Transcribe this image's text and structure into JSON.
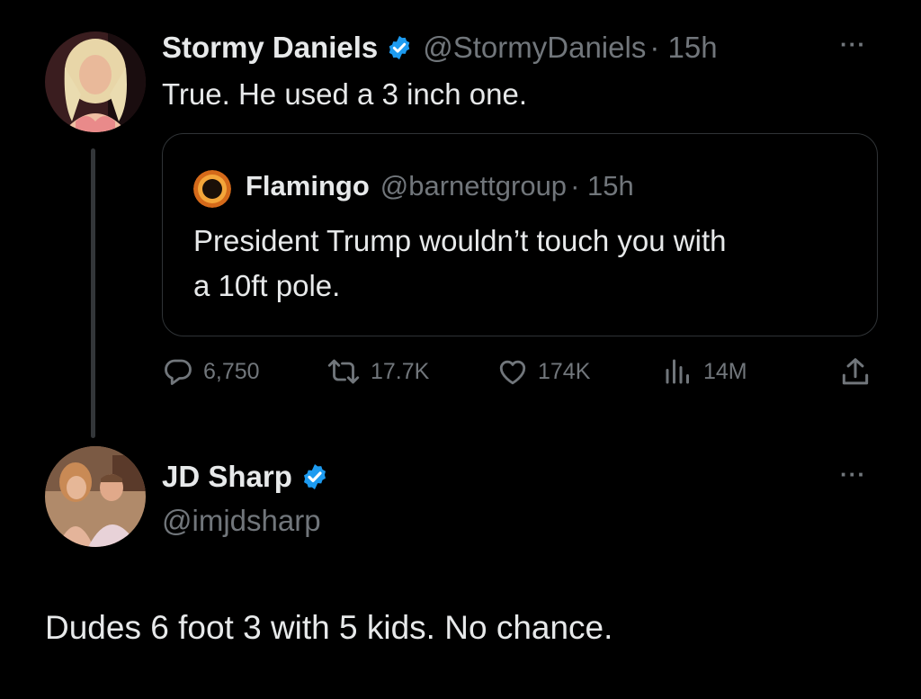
{
  "tweets": [
    {
      "display_name": "Stormy Daniels",
      "handle": "@StormyDaniels",
      "time": "· 15h",
      "text": "True. He used a 3 inch one.",
      "avatar": "woman-blonde-avatar",
      "quote": {
        "display_name": "Flamingo",
        "handle": "@barnettgroup",
        "time": "· 15h",
        "text_line1": "President Trump wouldn’t touch you with",
        "text_line2": "a 10ft pole.",
        "avatar": "eclipse-avatar"
      },
      "stats": {
        "replies": "6,750",
        "reposts": "17.7K",
        "likes": "174K",
        "views": "14M"
      }
    },
    {
      "display_name": "JD Sharp",
      "handle": "@imjdsharp",
      "text": "Dudes 6 foot 3 with 5 kids.  No chance.",
      "avatar": "couple-photo-avatar"
    }
  ],
  "icons": {
    "verified": "verified-badge-icon",
    "more": "more-options-icon",
    "reply": "reply-icon",
    "repost": "repost-icon",
    "like": "heart-icon",
    "views": "views-chart-icon",
    "share": "share-icon"
  },
  "colors": {
    "background": "#000000",
    "text": "#e7e9ea",
    "secondary": "#71767b",
    "verified": "#1d9bf0",
    "border": "#2f3336"
  }
}
